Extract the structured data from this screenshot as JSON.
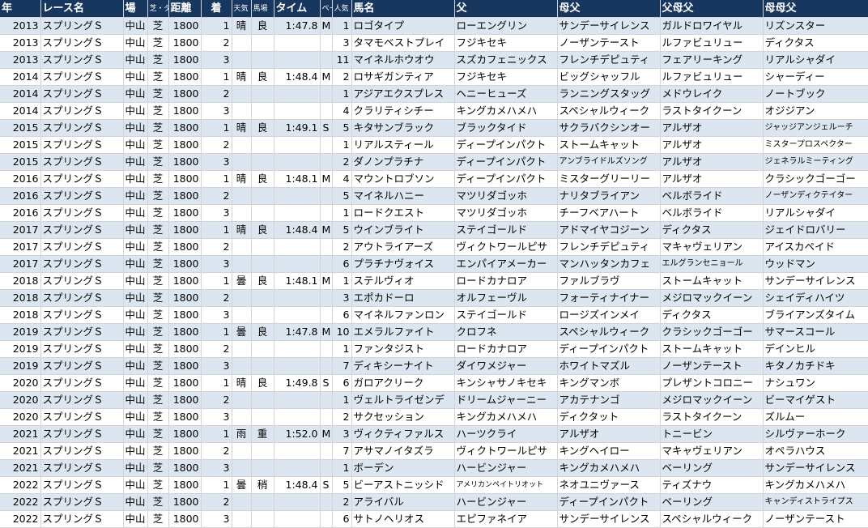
{
  "headers": [
    "年",
    "レース名",
    "場",
    "芝・ダ",
    "距離",
    "着",
    "天気",
    "馬場",
    "タイム",
    "ペース",
    "人気",
    "馬名",
    "父",
    "母父",
    "父母父",
    "母母父"
  ],
  "rows": [
    {
      "year": "2013",
      "race": "スプリングＳ",
      "venue": "中山",
      "surface": "芝",
      "dist": "1800",
      "place": "1",
      "weather": "晴",
      "track": "良",
      "time": "1:47.8",
      "pace": "M",
      "pop": "1",
      "horse": "ロゴタイプ",
      "sire": "ローエングリン",
      "bms": "サンデーサイレンス",
      "sire_sire": "ガルドロワイヤル",
      "dam_dam_sire": "リズンスター"
    },
    {
      "year": "2013",
      "race": "スプリングＳ",
      "venue": "中山",
      "surface": "芝",
      "dist": "1800",
      "place": "2",
      "weather": "",
      "track": "",
      "time": "",
      "pace": "",
      "pop": "3",
      "horse": "タマモベストプレイ",
      "sire": "フジキセキ",
      "bms": "ノーザンテースト",
      "sire_sire": "ルファビュリュー",
      "dam_dam_sire": "ディクタス"
    },
    {
      "year": "2013",
      "race": "スプリングＳ",
      "venue": "中山",
      "surface": "芝",
      "dist": "1800",
      "place": "3",
      "weather": "",
      "track": "",
      "time": "",
      "pace": "",
      "pop": "11",
      "horse": "マイネルホウオウ",
      "sire": "スズカフェニックス",
      "bms": "フレンチデピュティ",
      "sire_sire": "フェアリーキング",
      "dam_dam_sire": "リアルシャダイ"
    },
    {
      "year": "2014",
      "race": "スプリングＳ",
      "venue": "中山",
      "surface": "芝",
      "dist": "1800",
      "place": "1",
      "weather": "晴",
      "track": "良",
      "time": "1:48.4",
      "pace": "M",
      "pop": "2",
      "horse": "ロサギガンティア",
      "sire": "フジキセキ",
      "bms": "ビッグシャッフル",
      "sire_sire": "ルファビュリュー",
      "dam_dam_sire": "シャーディー"
    },
    {
      "year": "2014",
      "race": "スプリングＳ",
      "venue": "中山",
      "surface": "芝",
      "dist": "1800",
      "place": "2",
      "weather": "",
      "track": "",
      "time": "",
      "pace": "",
      "pop": "1",
      "horse": "アジアエクスプレス",
      "sire": "ヘニーヒューズ",
      "bms": "ランニングスタッグ",
      "sire_sire": "メドウレイク",
      "dam_dam_sire": "ノートブック"
    },
    {
      "year": "2014",
      "race": "スプリングＳ",
      "venue": "中山",
      "surface": "芝",
      "dist": "1800",
      "place": "3",
      "weather": "",
      "track": "",
      "time": "",
      "pace": "",
      "pop": "4",
      "horse": "クラリティシチー",
      "sire": "キングカメハメハ",
      "bms": "スペシャルウィーク",
      "sire_sire": "ラストタイクーン",
      "dam_dam_sire": "オジジアン"
    },
    {
      "year": "2015",
      "race": "スプリングＳ",
      "venue": "中山",
      "surface": "芝",
      "dist": "1800",
      "place": "1",
      "weather": "晴",
      "track": "良",
      "time": "1:49.1",
      "pace": "S",
      "pop": "5",
      "horse": "キタサンブラック",
      "sire": "ブラックタイド",
      "bms": "サクラバクシンオー",
      "sire_sire": "アルザオ",
      "dam_dam_sire": "ジャッジアンジェルーチ"
    },
    {
      "year": "2015",
      "race": "スプリングＳ",
      "venue": "中山",
      "surface": "芝",
      "dist": "1800",
      "place": "2",
      "weather": "",
      "track": "",
      "time": "",
      "pace": "",
      "pop": "1",
      "horse": "リアルスティール",
      "sire": "ディープインパクト",
      "bms": "ストームキャット",
      "sire_sire": "アルザオ",
      "dam_dam_sire": "ミスタープロスペクター"
    },
    {
      "year": "2015",
      "race": "スプリングＳ",
      "venue": "中山",
      "surface": "芝",
      "dist": "1800",
      "place": "3",
      "weather": "",
      "track": "",
      "time": "",
      "pace": "",
      "pop": "2",
      "horse": "ダノンプラチナ",
      "sire": "ディープインパクト",
      "bms": "アンブライドルズソング",
      "sire_sire": "アルザオ",
      "dam_dam_sire": "ジェネラルミーティング"
    },
    {
      "year": "2016",
      "race": "スプリングＳ",
      "venue": "中山",
      "surface": "芝",
      "dist": "1800",
      "place": "1",
      "weather": "晴",
      "track": "良",
      "time": "1:48.1",
      "pace": "M",
      "pop": "4",
      "horse": "マウントロブソン",
      "sire": "ディープインパクト",
      "bms": "ミスターグリーリー",
      "sire_sire": "アルザオ",
      "dam_dam_sire": "クラシックゴーゴー"
    },
    {
      "year": "2016",
      "race": "スプリングＳ",
      "venue": "中山",
      "surface": "芝",
      "dist": "1800",
      "place": "2",
      "weather": "",
      "track": "",
      "time": "",
      "pace": "",
      "pop": "5",
      "horse": "マイネルハニー",
      "sire": "マツリダゴッホ",
      "bms": "ナリタブライアン",
      "sire_sire": "ベルボライド",
      "dam_dam_sire": "ノーザンディクテイター"
    },
    {
      "year": "2016",
      "race": "スプリングＳ",
      "venue": "中山",
      "surface": "芝",
      "dist": "1800",
      "place": "3",
      "weather": "",
      "track": "",
      "time": "",
      "pace": "",
      "pop": "1",
      "horse": "ロードクエスト",
      "sire": "マツリダゴッホ",
      "bms": "チーフベアハート",
      "sire_sire": "ベルボライド",
      "dam_dam_sire": "リアルシャダイ"
    },
    {
      "year": "2017",
      "race": "スプリングＳ",
      "venue": "中山",
      "surface": "芝",
      "dist": "1800",
      "place": "1",
      "weather": "晴",
      "track": "良",
      "time": "1:48.4",
      "pace": "M",
      "pop": "5",
      "horse": "ウインブライト",
      "sire": "ステイゴールド",
      "bms": "アドマイヤコジーン",
      "sire_sire": "ディクタス",
      "dam_dam_sire": "ジェイドロバリー"
    },
    {
      "year": "2017",
      "race": "スプリングＳ",
      "venue": "中山",
      "surface": "芝",
      "dist": "1800",
      "place": "2",
      "weather": "",
      "track": "",
      "time": "",
      "pace": "",
      "pop": "2",
      "horse": "アウトライアーズ",
      "sire": "ヴィクトワールピサ",
      "bms": "フレンチデピュティ",
      "sire_sire": "マキャヴェリアン",
      "dam_dam_sire": "アイスカペイド"
    },
    {
      "year": "2017",
      "race": "スプリングＳ",
      "venue": "中山",
      "surface": "芝",
      "dist": "1800",
      "place": "3",
      "weather": "",
      "track": "",
      "time": "",
      "pace": "",
      "pop": "6",
      "horse": "プラチナヴォイス",
      "sire": "エンパイアメーカー",
      "bms": "マンハッタンカフェ",
      "sire_sire": "エルグランセニョール",
      "dam_dam_sire": "ウッドマン"
    },
    {
      "year": "2018",
      "race": "スプリングＳ",
      "venue": "中山",
      "surface": "芝",
      "dist": "1800",
      "place": "1",
      "weather": "曇",
      "track": "良",
      "time": "1:48.1",
      "pace": "M",
      "pop": "1",
      "horse": "ステルヴィオ",
      "sire": "ロードカナロア",
      "bms": "ファルブラヴ",
      "sire_sire": "ストームキャット",
      "dam_dam_sire": "サンデーサイレンス"
    },
    {
      "year": "2018",
      "race": "スプリングＳ",
      "venue": "中山",
      "surface": "芝",
      "dist": "1800",
      "place": "2",
      "weather": "",
      "track": "",
      "time": "",
      "pace": "",
      "pop": "3",
      "horse": "エポカドーロ",
      "sire": "オルフェーヴル",
      "bms": "フォーティナイナー",
      "sire_sire": "メジロマックイーン",
      "dam_dam_sire": "シェイディハイツ"
    },
    {
      "year": "2018",
      "race": "スプリングＳ",
      "venue": "中山",
      "surface": "芝",
      "dist": "1800",
      "place": "3",
      "weather": "",
      "track": "",
      "time": "",
      "pace": "",
      "pop": "6",
      "horse": "マイネルファンロン",
      "sire": "ステイゴールド",
      "bms": "ロージズインメイ",
      "sire_sire": "ディクタス",
      "dam_dam_sire": "ブライアンズタイム"
    },
    {
      "year": "2019",
      "race": "スプリングＳ",
      "venue": "中山",
      "surface": "芝",
      "dist": "1800",
      "place": "1",
      "weather": "曇",
      "track": "良",
      "time": "1:47.8",
      "pace": "M",
      "pop": "10",
      "horse": "エメラルファイト",
      "sire": "クロフネ",
      "bms": "スペシャルウィーク",
      "sire_sire": "クラシックゴーゴー",
      "dam_dam_sire": "サマースコール"
    },
    {
      "year": "2019",
      "race": "スプリングＳ",
      "venue": "中山",
      "surface": "芝",
      "dist": "1800",
      "place": "2",
      "weather": "",
      "track": "",
      "time": "",
      "pace": "",
      "pop": "1",
      "horse": "ファンタジスト",
      "sire": "ロードカナロア",
      "bms": "ディープインパクト",
      "sire_sire": "ストームキャット",
      "dam_dam_sire": "デインヒル"
    },
    {
      "year": "2019",
      "race": "スプリングＳ",
      "venue": "中山",
      "surface": "芝",
      "dist": "1800",
      "place": "3",
      "weather": "",
      "track": "",
      "time": "",
      "pace": "",
      "pop": "7",
      "horse": "ディキシーナイト",
      "sire": "ダイワメジャー",
      "bms": "ホワイトマズル",
      "sire_sire": "ノーザンテースト",
      "dam_dam_sire": "キタノカチドキ"
    },
    {
      "year": "2020",
      "race": "スプリングＳ",
      "venue": "中山",
      "surface": "芝",
      "dist": "1800",
      "place": "1",
      "weather": "晴",
      "track": "良",
      "time": "1:49.8",
      "pace": "S",
      "pop": "6",
      "horse": "ガロアクリーク",
      "sire": "キンシャサノキセキ",
      "bms": "キングマンボ",
      "sire_sire": "プレザントコロニー",
      "dam_dam_sire": "ナシュワン"
    },
    {
      "year": "2020",
      "race": "スプリングＳ",
      "venue": "中山",
      "surface": "芝",
      "dist": "1800",
      "place": "2",
      "weather": "",
      "track": "",
      "time": "",
      "pace": "",
      "pop": "1",
      "horse": "ヴェルトライゼンデ",
      "sire": "ドリームジャーニー",
      "bms": "アカテナンゴ",
      "sire_sire": "メジロマックイーン",
      "dam_dam_sire": "ビーマイゲスト"
    },
    {
      "year": "2020",
      "race": "スプリングＳ",
      "venue": "中山",
      "surface": "芝",
      "dist": "1800",
      "place": "3",
      "weather": "",
      "track": "",
      "time": "",
      "pace": "",
      "pop": "2",
      "horse": "サクセッション",
      "sire": "キングカメハメハ",
      "bms": "ディクタット",
      "sire_sire": "ラストタイクーン",
      "dam_dam_sire": "ズルムー"
    },
    {
      "year": "2021",
      "race": "スプリングＳ",
      "venue": "中山",
      "surface": "芝",
      "dist": "1800",
      "place": "1",
      "weather": "雨",
      "track": "重",
      "time": "1:52.0",
      "pace": "M",
      "pop": "3",
      "horse": "ヴィクティファルス",
      "sire": "ハーツクライ",
      "bms": "アルザオ",
      "sire_sire": "トニービン",
      "dam_dam_sire": "シルヴァーホーク"
    },
    {
      "year": "2021",
      "race": "スプリングＳ",
      "venue": "中山",
      "surface": "芝",
      "dist": "1800",
      "place": "2",
      "weather": "",
      "track": "",
      "time": "",
      "pace": "",
      "pop": "7",
      "horse": "アサマノイタズラ",
      "sire": "ヴィクトワールピサ",
      "bms": "キングヘイロー",
      "sire_sire": "マキャヴェリアン",
      "dam_dam_sire": "オペラハウス"
    },
    {
      "year": "2021",
      "race": "スプリングＳ",
      "venue": "中山",
      "surface": "芝",
      "dist": "1800",
      "place": "3",
      "weather": "",
      "track": "",
      "time": "",
      "pace": "",
      "pop": "1",
      "horse": "ボーデン",
      "sire": "ハービンジャー",
      "bms": "キングカメハメハ",
      "sire_sire": "ベーリング",
      "dam_dam_sire": "サンデーサイレンス"
    },
    {
      "year": "2022",
      "race": "スプリングＳ",
      "venue": "中山",
      "surface": "芝",
      "dist": "1800",
      "place": "1",
      "weather": "曇",
      "track": "稍",
      "time": "1:48.4",
      "pace": "S",
      "pop": "5",
      "horse": "ビーアストニッシド",
      "sire": "アメリカンペイトリオット",
      "bms": "ネオユニヴァース",
      "sire_sire": "ティズナウ",
      "dam_dam_sire": "キングカメハメハ"
    },
    {
      "year": "2022",
      "race": "スプリングＳ",
      "venue": "中山",
      "surface": "芝",
      "dist": "1800",
      "place": "2",
      "weather": "",
      "track": "",
      "time": "",
      "pace": "",
      "pop": "2",
      "horse": "アライバル",
      "sire": "ハービンジャー",
      "bms": "ディープインパクト",
      "sire_sire": "ベーリング",
      "dam_dam_sire": "キャンディストライプス"
    },
    {
      "year": "2022",
      "race": "スプリングＳ",
      "venue": "中山",
      "surface": "芝",
      "dist": "1800",
      "place": "3",
      "weather": "",
      "track": "",
      "time": "",
      "pace": "",
      "pop": "6",
      "horse": "サトノヘリオス",
      "sire": "エピファネイア",
      "bms": "サンデーサイレンス",
      "sire_sire": "スペシャルウィーク",
      "dam_dam_sire": "ノーザンテースト"
    }
  ]
}
